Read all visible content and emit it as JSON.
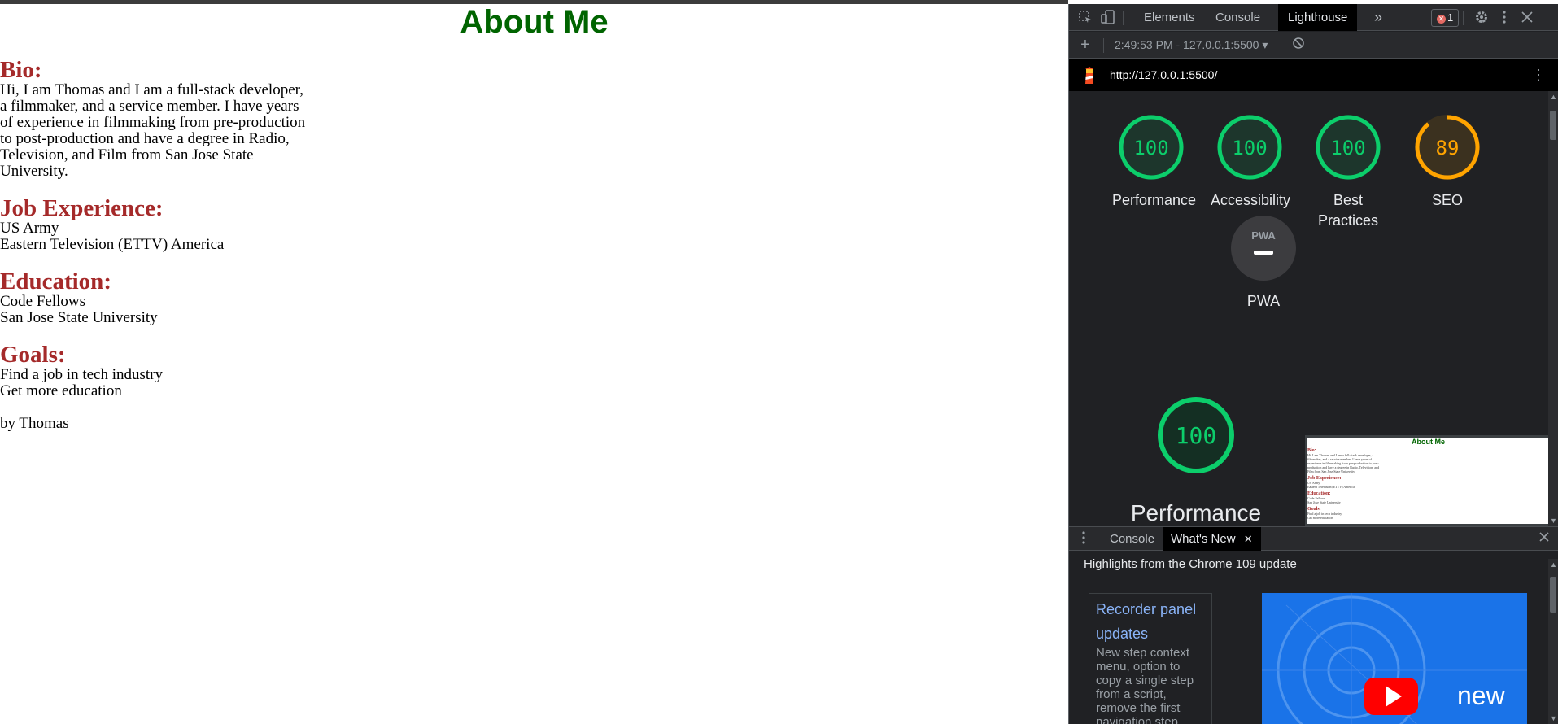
{
  "page": {
    "title": "About Me",
    "sections": [
      {
        "heading": "Bio:",
        "lines": [
          "Hi, I am Thomas and I am a full-stack developer, a filmmaker, and a service member. I have years of experience in filmmaking from pre-production to post-production and have a degree in Radio, Television, and Film from San Jose State University."
        ]
      },
      {
        "heading": "Job Experience:",
        "lines": [
          "US Army",
          "Eastern Television (ETTV) America"
        ]
      },
      {
        "heading": "Education:",
        "lines": [
          "Code Fellows",
          "San Jose State University"
        ]
      },
      {
        "heading": "Goals:",
        "lines": [
          "Find a job in tech industry",
          "Get more education"
        ]
      }
    ],
    "byline": "by Thomas"
  },
  "devtools": {
    "tabs": {
      "elements": "Elements",
      "console": "Console",
      "lighthouse": "Lighthouse",
      "more": "»"
    },
    "error_count": "1",
    "toolbar": {
      "add": "+",
      "report_selector": "2:49:53 PM - 127.0.0.1:5500 ▾"
    },
    "lighthouse": {
      "url": "http://127.0.0.1:5500/",
      "scores": [
        {
          "label": "Performance",
          "value": 100,
          "color": "#0cce6b"
        },
        {
          "label": "Accessibility",
          "value": 100,
          "color": "#0cce6b"
        },
        {
          "label": "Best Practices",
          "value": 100,
          "color": "#0cce6b"
        },
        {
          "label": "SEO",
          "value": 89,
          "color": "#ffa400"
        }
      ],
      "pwa_label": "PWA",
      "pwa_badge": "PWA",
      "featured": {
        "label": "Performance",
        "value": "100"
      }
    },
    "drawer": {
      "console_tab": "Console",
      "whats_new_tab": "What's New",
      "close_tab": "✕",
      "highlights": "Highlights from the Chrome 109 update",
      "card_title": "Recorder panel updates",
      "card_desc": "New step context menu, option to copy a single step from a script, remove the first navigation step.",
      "image_text": "new"
    }
  }
}
